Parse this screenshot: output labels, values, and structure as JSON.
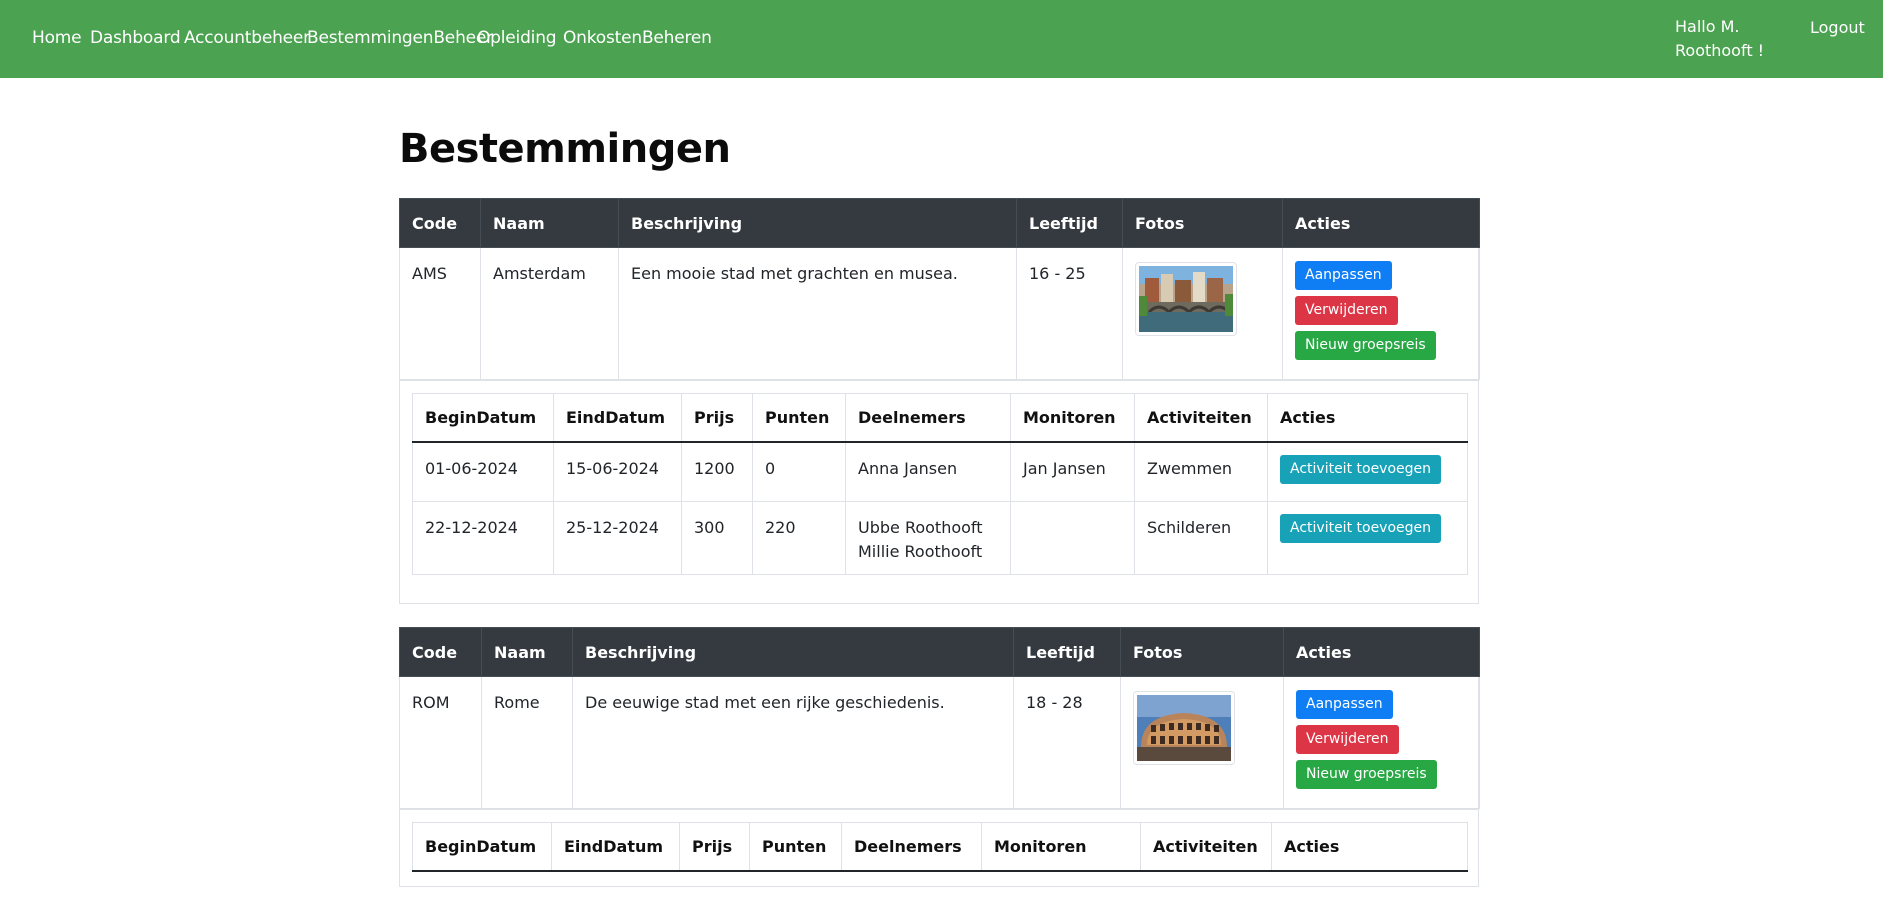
{
  "nav": {
    "links": [
      "Home",
      "Dashboard",
      "Accountbeheer",
      "BestemmingenBeheer",
      "Opleiding",
      "OnkostenBeheren"
    ],
    "greeting": "Hallo M.\nRoothooft !",
    "logout": "Logout"
  },
  "page_title": "Bestemmingen",
  "dest_headers": [
    "Code",
    "Naam",
    "Beschrijving",
    "Leeftijd",
    "Fotos",
    "Acties"
  ],
  "trip_headers": [
    "BeginDatum",
    "EindDatum",
    "Prijs",
    "Punten",
    "Deelnemers",
    "Monitoren",
    "Activiteiten",
    "Acties"
  ],
  "buttons": {
    "edit": "Aanpassen",
    "delete": "Verwijderen",
    "new_trip": "Nieuw groepsreis",
    "add_activity": "Activiteit toevoegen"
  },
  "destinations": [
    {
      "code": "AMS",
      "name": "Amsterdam",
      "description": "Een mooie stad met grachten en musea.",
      "age": "16 - 25",
      "photo_icon": "amsterdam-canal-photo",
      "trips": [
        {
          "begin": "01-06-2024",
          "end": "15-06-2024",
          "price": "1200",
          "points": "0",
          "participants": [
            "Anna Jansen"
          ],
          "monitors": "Jan Jansen",
          "activities": "Zwemmen"
        },
        {
          "begin": "22-12-2024",
          "end": "25-12-2024",
          "price": "300",
          "points": "220",
          "participants": [
            "Ubbe Roothooft",
            "Millie Roothooft"
          ],
          "monitors": "",
          "activities": "Schilderen"
        }
      ]
    },
    {
      "code": "ROM",
      "name": "Rome",
      "description": "De eeuwige stad met een rijke geschiedenis.",
      "age": "18 - 28",
      "photo_icon": "colosseum-photo",
      "trips": []
    }
  ],
  "colors": {
    "navbar": "#4ba250",
    "table_header": "#343a40",
    "primary": "#0f7ef5",
    "danger": "#dc3545",
    "success": "#28a745",
    "info": "#17a2b8"
  }
}
